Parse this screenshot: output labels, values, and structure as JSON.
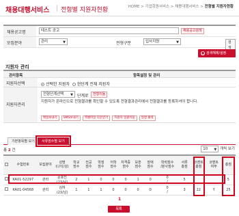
{
  "header": {
    "title": "채용대행서비스",
    "subtitle": "전형별 지원자현황",
    "breadcrumb": [
      "HOME",
      "기업회원서비스",
      "채용대행서비스"
    ],
    "breadcrumb_current": "전형별 지원자현황"
  },
  "search": {
    "job_title_label": "채용공고명",
    "job_title_value": "테스트 공고",
    "job_title_link": "채용공고검색",
    "field_label": "모집분야",
    "field_value": "관리",
    "stage_label": "전형구분",
    "stage_value": "입사지원",
    "search_btn": "검색",
    "detail_btn": "검색해제/설정"
  },
  "manage": {
    "title": "지원자 관리",
    "col_left": "관리항목",
    "col_right": "항목설정 및 관리",
    "select_label": "지원자선택",
    "opt_selected": "선택한 지원자",
    "opt_all": "현단계 전체 지원자",
    "mgmt_label": "지원자관리",
    "stage_select": "전형단계선택",
    "stage_suffix": "단계로",
    "stage_link": "전형이동",
    "note": "지원자가 온라인으로 전형결과를 확인할 수 있도록 전형결과관리에서 전형결과를 등록하셔야 합니다.",
    "actions": [
      "메일보내기",
      "SMS보내기",
      "엑셀파일 다운받기",
      "지원자 일괄이동",
      "일정 출력"
    ]
  },
  "tabs": [
    "기본항목별 보기",
    "서류점수별 보기"
  ],
  "count_label": "총",
  "count_value": "2",
  "count_unit": "건",
  "per_page": "10",
  "per_page_unit": "개씩 보기",
  "table": {
    "headers": [
      "수험번호",
      "모집분야",
      "성명\n(나이/성)",
      "학교\n점수",
      "전공\n점수",
      "학점\n점수",
      "어학\n점수",
      "자격증\n점수",
      "보훈\n점수",
      "장애\n점수",
      "학력점수\n/분사점수",
      "서류\n총점",
      "코멘트\n총점",
      "코멘트\n여부",
      "총점"
    ],
    "rows": [
      [
        "KA01-52297",
        "관리",
        "문호진\n(23/남)",
        "2",
        "1",
        "0",
        "0",
        "0",
        "1",
        "0",
        "0\n/",
        "5",
        "",
        "",
        "5"
      ],
      [
        "KA01-04568",
        "관리",
        "김하\n(23/남)",
        "1",
        "1",
        "1",
        "0",
        "0",
        "0",
        "0",
        "0\n/",
        "3",
        "22",
        "Y",
        "25"
      ]
    ]
  },
  "pager": "1",
  "list_btn": "목록"
}
